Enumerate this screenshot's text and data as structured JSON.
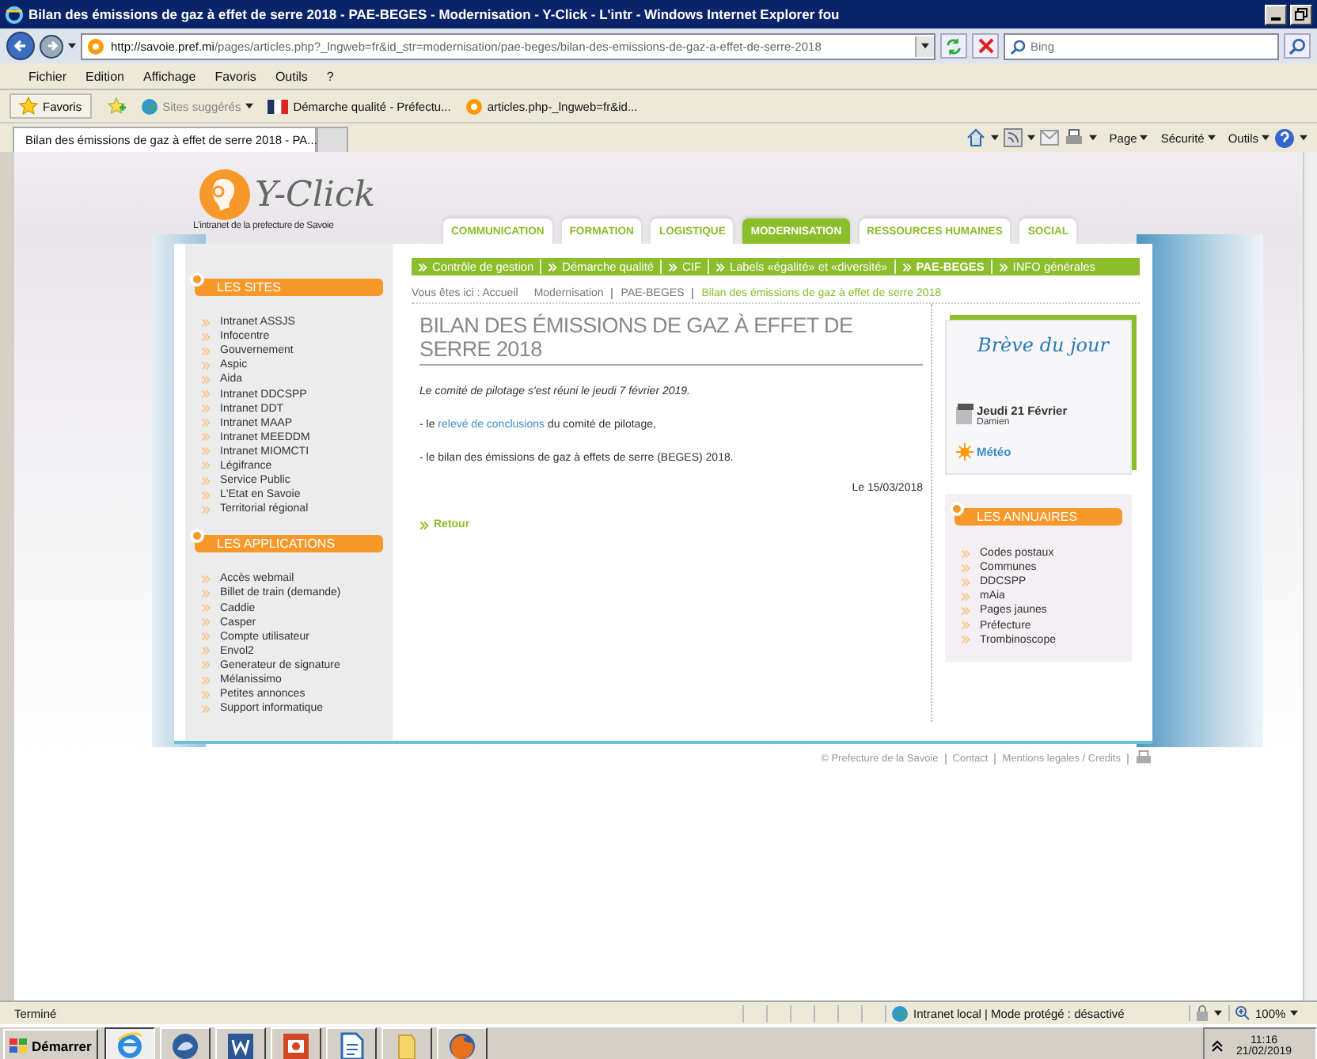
{
  "window": {
    "title": "Bilan des émissions de gaz à effet de serre 2018 - PAE-BEGES - Modernisation - Y-Click - L'intr - Windows Internet Explorer fou"
  },
  "address_bar": {
    "url_host": "http://savoie.pref.mi",
    "url_path": "/pages/articles.php?_lngweb=fr&id_str=modernisation/pae-beges/bilan-des-emissions-de-gaz-a-effet-de-serre-2018",
    "search_placeholder": "Bing"
  },
  "menu": [
    "Fichier",
    "Edition",
    "Affichage",
    "Favoris",
    "Outils",
    "?"
  ],
  "favorites_bar": {
    "favorites": "Favoris",
    "links": [
      {
        "label": "Sites suggérés",
        "kind": "suggested"
      },
      {
        "label": "Démarche qualité - Préfectu...",
        "kind": "flag"
      },
      {
        "label": "articles.php-_lngweb=fr&id...",
        "kind": "page"
      }
    ]
  },
  "browser_tabs": [
    {
      "label": "Bilan des émissions de gaz à effet de serre 2018 - PA...",
      "selected": true
    }
  ],
  "command_bar": [
    "Page",
    "Sécurité",
    "Outils"
  ],
  "site": {
    "logo_text": "Y-Click",
    "tagline": "L'intranet de la prefecture de Savoie",
    "tabs": [
      {
        "label": "COMMUNICATION",
        "selected": false
      },
      {
        "label": "FORMATION",
        "selected": false
      },
      {
        "label": "LOGISTIQUE",
        "selected": false
      },
      {
        "label": "MODERNISATION",
        "selected": true
      },
      {
        "label": "RESSOURCES HUMAINES",
        "selected": false
      },
      {
        "label": "SOCIAL",
        "selected": false
      }
    ],
    "subnav": [
      {
        "label": "Contrôle de gestion",
        "selected": false
      },
      {
        "label": "Démarche qualité",
        "selected": false
      },
      {
        "label": "CIF",
        "selected": false
      },
      {
        "label": "Labels «égalité» et «diversité»",
        "selected": false
      },
      {
        "label": "PAE-BEGES",
        "selected": true
      },
      {
        "label": "INFO générales",
        "selected": false
      }
    ],
    "breadcrumb": [
      {
        "label": "Vous êtes ici : Accueil",
        "current": false
      },
      {
        "label": "Modernisation",
        "current": false
      },
      {
        "label": "PAE-BEGES",
        "current": false
      },
      {
        "label": "Bilan des émissions de gaz à effet de serre 2018",
        "current": true
      }
    ],
    "sidebar": [
      {
        "title": "LES SITES",
        "items": [
          "Intranet ASSJS",
          "Infocentre",
          "Gouvernement",
          "Aspic",
          "Aida",
          "Intranet DDCSPP",
          "Intranet DDT",
          "Intranet MAAP",
          "Intranet MEEDDM",
          "Intranet MIOMCTI",
          "Légifrance",
          "Service Public",
          "L'Etat en Savoie",
          "Territorial régional"
        ]
      },
      {
        "title": "LES APPLICATIONS",
        "items": [
          "Accès webmail",
          "Billet de train (demande)",
          "Caddie",
          "Casper",
          "Compte utilisateur",
          "Envol2",
          "Generateur de signature",
          "Mélanissimo",
          "Petites annonces",
          "Support informatique"
        ]
      }
    ],
    "article": {
      "title": "BILAN DES ÉMISSIONS DE GAZ À EFFET DE SERRE 2018",
      "intro": "Le comité de pilotage s'est réuni le jeudi 7 février 2019.",
      "line_1": {
        "before": "- le ",
        "link": "relevé de conclusions",
        "after": " du comité de pilotage,"
      },
      "line_2": "- le bilan des émissions de gaz à effets de serre (BEGES) 2018.",
      "date": "Le 15/03/2018",
      "back": "Retour"
    },
    "breve": {
      "title": "Brève du jour",
      "date": "Jeudi 21 Février",
      "saint": "Damien",
      "weather": "Météo"
    },
    "annuaires": {
      "title": "LES ANNUAIRES",
      "items": [
        "Codes postaux",
        "Communes",
        "DDCSPP",
        "mAia",
        "Pages jaunes",
        "Préfecture",
        "Trombinoscope"
      ]
    },
    "footer": [
      "© Prefecture de la Savoie",
      "Contact",
      "Mentions legales / Credits"
    ]
  },
  "status_bar": {
    "status": "Terminé",
    "zone": "Intranet local | Mode protégé : désactivé",
    "zoom": "100%"
  },
  "taskbar": {
    "start": "Démarrer",
    "time": "11:16",
    "date": "21/02/2019"
  }
}
